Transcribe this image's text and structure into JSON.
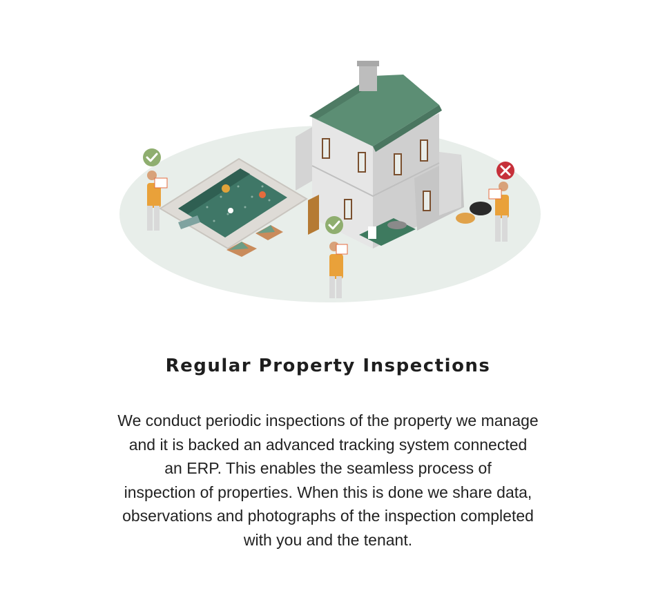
{
  "section": {
    "title": "Regular Property Inspections",
    "description_lines": [
      "We conduct periodic inspections of the property we manage",
      "and it is backed an advanced tracking system connected",
      "an ERP.  This enables the seamless process of",
      "inspection of properties.  When this is done we share data,",
      "observations and photographs of the inspection completed",
      "with you and the tenant."
    ]
  },
  "illustration": {
    "icons": [
      "check-badge-icon",
      "check-badge-icon",
      "cross-badge-icon"
    ],
    "colors": {
      "ground": "#e8eeea",
      "roof": "#5c8e74",
      "walls": "#dcdcdc",
      "pool_water": "#3f7767",
      "check_badge": "#8fae6f",
      "cross_badge": "#c6303a",
      "inspector_jacket": "#e9a13a"
    }
  }
}
